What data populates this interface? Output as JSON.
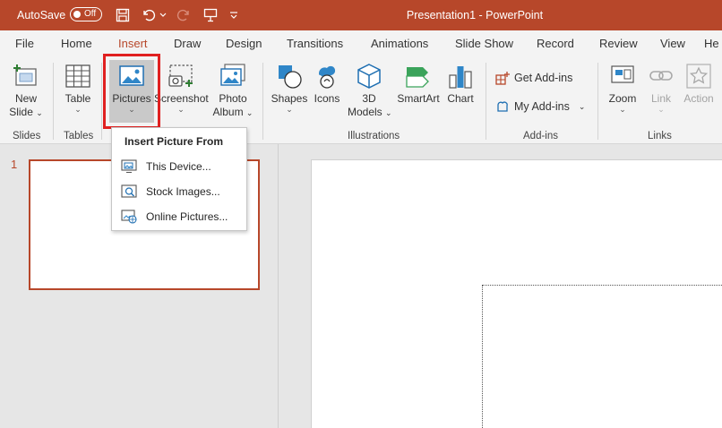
{
  "titlebar": {
    "autosave_label": "AutoSave",
    "toggle_state": "Off",
    "title": "Presentation1  -  PowerPoint",
    "bg_color": "#b7472a"
  },
  "tabs": [
    {
      "label": "File"
    },
    {
      "label": "Home"
    },
    {
      "label": "Insert",
      "active": true
    },
    {
      "label": "Draw"
    },
    {
      "label": "Design"
    },
    {
      "label": "Transitions"
    },
    {
      "label": "Animations"
    },
    {
      "label": "Slide Show"
    },
    {
      "label": "Record"
    },
    {
      "label": "Review"
    },
    {
      "label": "View"
    },
    {
      "label": "He"
    }
  ],
  "ribbon": {
    "new_slide": {
      "line1": "New",
      "line2": "Slide"
    },
    "table": "Table",
    "pictures": "Pictures",
    "screenshot": "Screenshot",
    "photo_album": {
      "line1": "Photo",
      "line2": "Album"
    },
    "shapes": "Shapes",
    "icons": "Icons",
    "models_3d": {
      "line1": "3D",
      "line2": "Models"
    },
    "smartart": "SmartArt",
    "chart": "Chart",
    "get_addins": "Get Add-ins",
    "my_addins": "My Add-ins",
    "zoom": "Zoom",
    "link": "Link",
    "action": "Action",
    "groups": {
      "slides": "Slides",
      "tables": "Tables",
      "illustrations": "Illustrations",
      "addins": "Add-ins",
      "links": "Links"
    }
  },
  "menu": {
    "title": "Insert Picture From",
    "items": [
      {
        "label": "This Device...",
        "icon": "this-device-icon"
      },
      {
        "label": "Stock Images...",
        "icon": "stock-images-icon"
      },
      {
        "label": "Online Pictures...",
        "icon": "online-pictures-icon"
      }
    ]
  },
  "slide_panel": {
    "slide_number": "1"
  },
  "colors": {
    "accent": "#b7472a",
    "highlight_box": "#e02020"
  }
}
